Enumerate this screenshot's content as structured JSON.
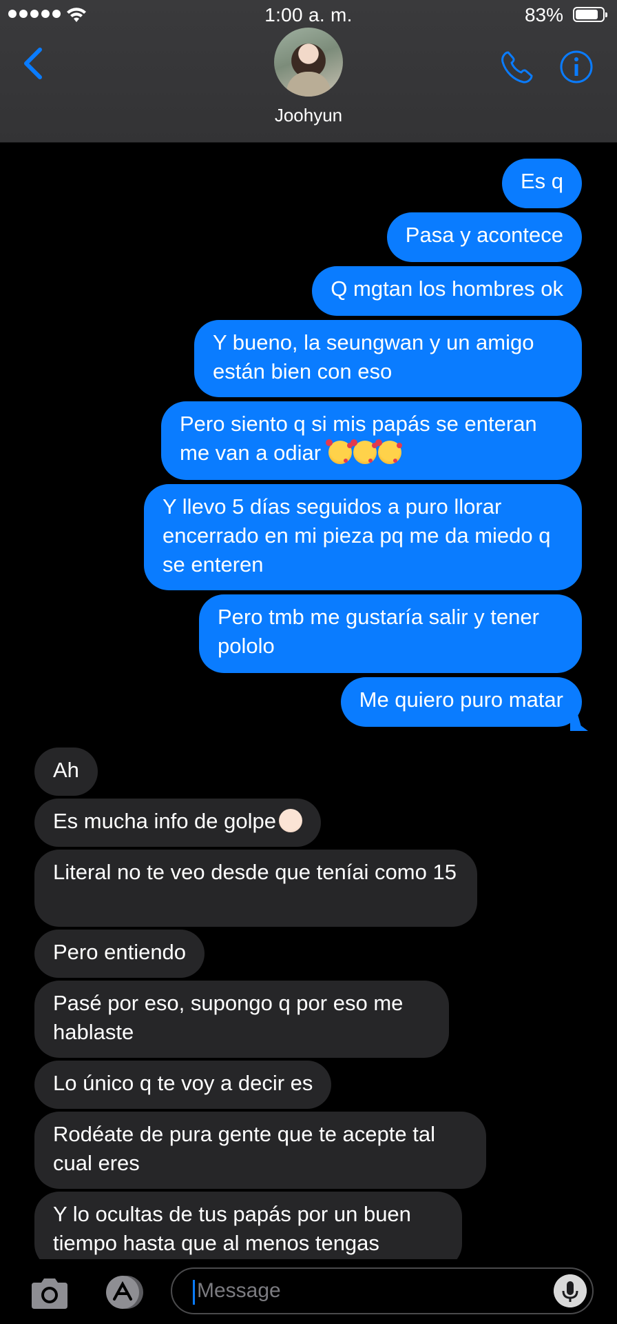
{
  "status_bar": {
    "time": "1:00 a. m.",
    "battery_percent": "83%",
    "battery_level": 0.83,
    "signal_dots": 5
  },
  "header": {
    "contact_name": "Joohyun",
    "back_icon": "chevron-left-icon",
    "call_icon": "phone-icon",
    "info_icon": "info-icon"
  },
  "messages": [
    {
      "side": "sent",
      "text": "Es q"
    },
    {
      "side": "sent",
      "text": "Pasa y acontece"
    },
    {
      "side": "sent",
      "text": "Q mgtan los hombres ok"
    },
    {
      "side": "sent",
      "text": "Y bueno, la seungwan y un amigo están bien con eso"
    },
    {
      "side": "sent",
      "text": "Pero siento q si mis papás se enteran me van a odiar",
      "emoji": "smiling-face-with-hearts x3"
    },
    {
      "side": "sent",
      "text": "Y llevo 5 días seguidos a puro llorar encerrado en mi pieza pq me da miedo q se enteren"
    },
    {
      "side": "sent",
      "text": "Pero tmb me gustaría salir y tener pololo"
    },
    {
      "side": "sent",
      "text": "Me quiero puro matar"
    },
    {
      "side": "received",
      "text": "Ah"
    },
    {
      "side": "received",
      "text": "Es mucha info de golpe",
      "emoji": "baby"
    },
    {
      "side": "received",
      "text": "Literal no te veo desde que teníai como 15"
    },
    {
      "side": "received",
      "text": "Pero entiendo"
    },
    {
      "side": "received",
      "text": "Pasé por eso, supongo q por eso me hablaste"
    },
    {
      "side": "received",
      "text": "Lo único q te voy a decir es"
    },
    {
      "side": "received",
      "text": "Rodéate de pura gente que te acepte tal cual eres"
    },
    {
      "side": "received",
      "text": "Y lo ocultas de tus papás por un buen tiempo hasta que al menos tengas"
    }
  ],
  "input_bar": {
    "placeholder": "Message",
    "camera_icon": "camera-icon",
    "apps_icon": "app-store-icon",
    "mic_icon": "microphone-icon"
  },
  "colors": {
    "sent_bubble": "#0a7cff",
    "received_bubble": "#262628",
    "accent": "#0a7cff",
    "header_bg": "#3a3a3c"
  }
}
